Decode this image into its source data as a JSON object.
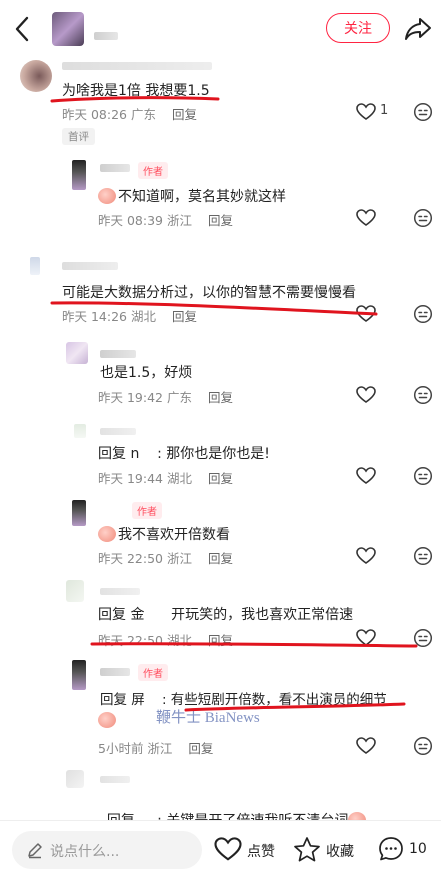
{
  "header": {
    "back_icon": "chevron-left-icon",
    "follow_label": "关注",
    "share_icon": "share-arrow-icon",
    "accent": "#ff2442"
  },
  "comments": {
    "c1": {
      "text": "为啥我是1倍 我想要1.5",
      "time": "昨天 08:26 广东",
      "reply": "回复",
      "likes": "1",
      "badge": "首评"
    },
    "c1r1": {
      "author_tag": "作者",
      "text": "不知道啊，莫名其妙就这样",
      "time": "昨天 08:39 浙江",
      "reply": "回复"
    },
    "c2": {
      "text": "可能是大数据分析过，以你的智慧不需要慢慢看",
      "time": "昨天 14:26 湖北",
      "reply": "回复"
    },
    "c2r1": {
      "text": "也是1.5，好烦",
      "time": "昨天 19:42 广东",
      "reply": "回复"
    },
    "c2r2": {
      "text": "回复 n    : 那你也是你也是!",
      "time": "昨天 19:44 湖北",
      "reply": "回复"
    },
    "c2r3": {
      "author_tag": "作者",
      "text": "我不喜欢开倍数看",
      "time": "昨天 22:50 浙江",
      "reply": "回复"
    },
    "c2r4": {
      "text": "回复 金      开玩笑的，我也喜欢正常倍速",
      "time": "昨天 22:50 湖北",
      "reply": "回复"
    },
    "c2r5": {
      "author_tag": "作者",
      "text": "回复 屏    : 有些短剧开倍数，看不出演员的细节",
      "watermark": "鞭牛士 BiaNews",
      "time": "5小时前 浙江",
      "reply": "回复"
    },
    "c2r6": {
      "text": "回复     : 关键是开了倍速我听不清台词"
    }
  },
  "bottom": {
    "input_placeholder": "说点什么...",
    "like_label": "点赞",
    "collect_label": "收藏",
    "comment_count": "10"
  }
}
